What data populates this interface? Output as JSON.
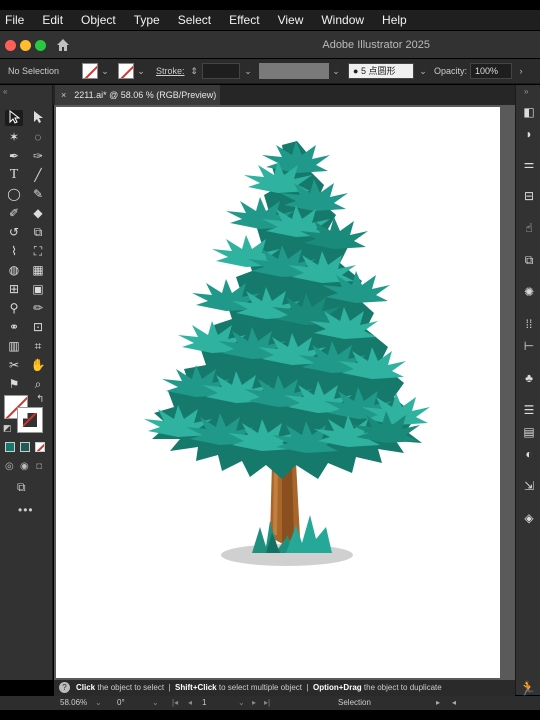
{
  "menu": [
    "File",
    "Edit",
    "Object",
    "Type",
    "Select",
    "Effect",
    "View",
    "Window",
    "Help"
  ],
  "app_title": "Adobe Illustrator 2025",
  "control_bar": {
    "selection": "No Selection",
    "stroke_label": "Stroke:",
    "brush": "5 点圆形",
    "opacity_label": "Opacity:",
    "opacity_value": "100%"
  },
  "document_tab": {
    "close": "×",
    "title": "2211.ai* @ 58.06 % (RGB/Preview)"
  },
  "status": {
    "click": "Click",
    "click_text": "the object to select",
    "shift": "Shift+Click",
    "shift_text": "to select multiple object",
    "option": "Option+Drag",
    "option_text": "the object to duplicate"
  },
  "bottom": {
    "zoom": "58.06%",
    "rotation": "0°",
    "artboard": "1",
    "tool": "Selection"
  },
  "colors": {
    "tree_dark": "#157a6b",
    "tree_mid": "#20998a",
    "tree_light": "#2fb3a0",
    "trunk": "#a8662b",
    "shadow": "#d0d0d0"
  },
  "icons": [
    "selection-tool-icon",
    "direct-selection-icon",
    "pen-tool-icon",
    "type-tool-icon",
    "ellipse-tool-icon",
    "paintbrush-icon",
    "eraser-icon",
    "rotate-icon",
    "scale-icon",
    "eyedropper-icon",
    "hand-icon",
    "zoom-icon"
  ]
}
